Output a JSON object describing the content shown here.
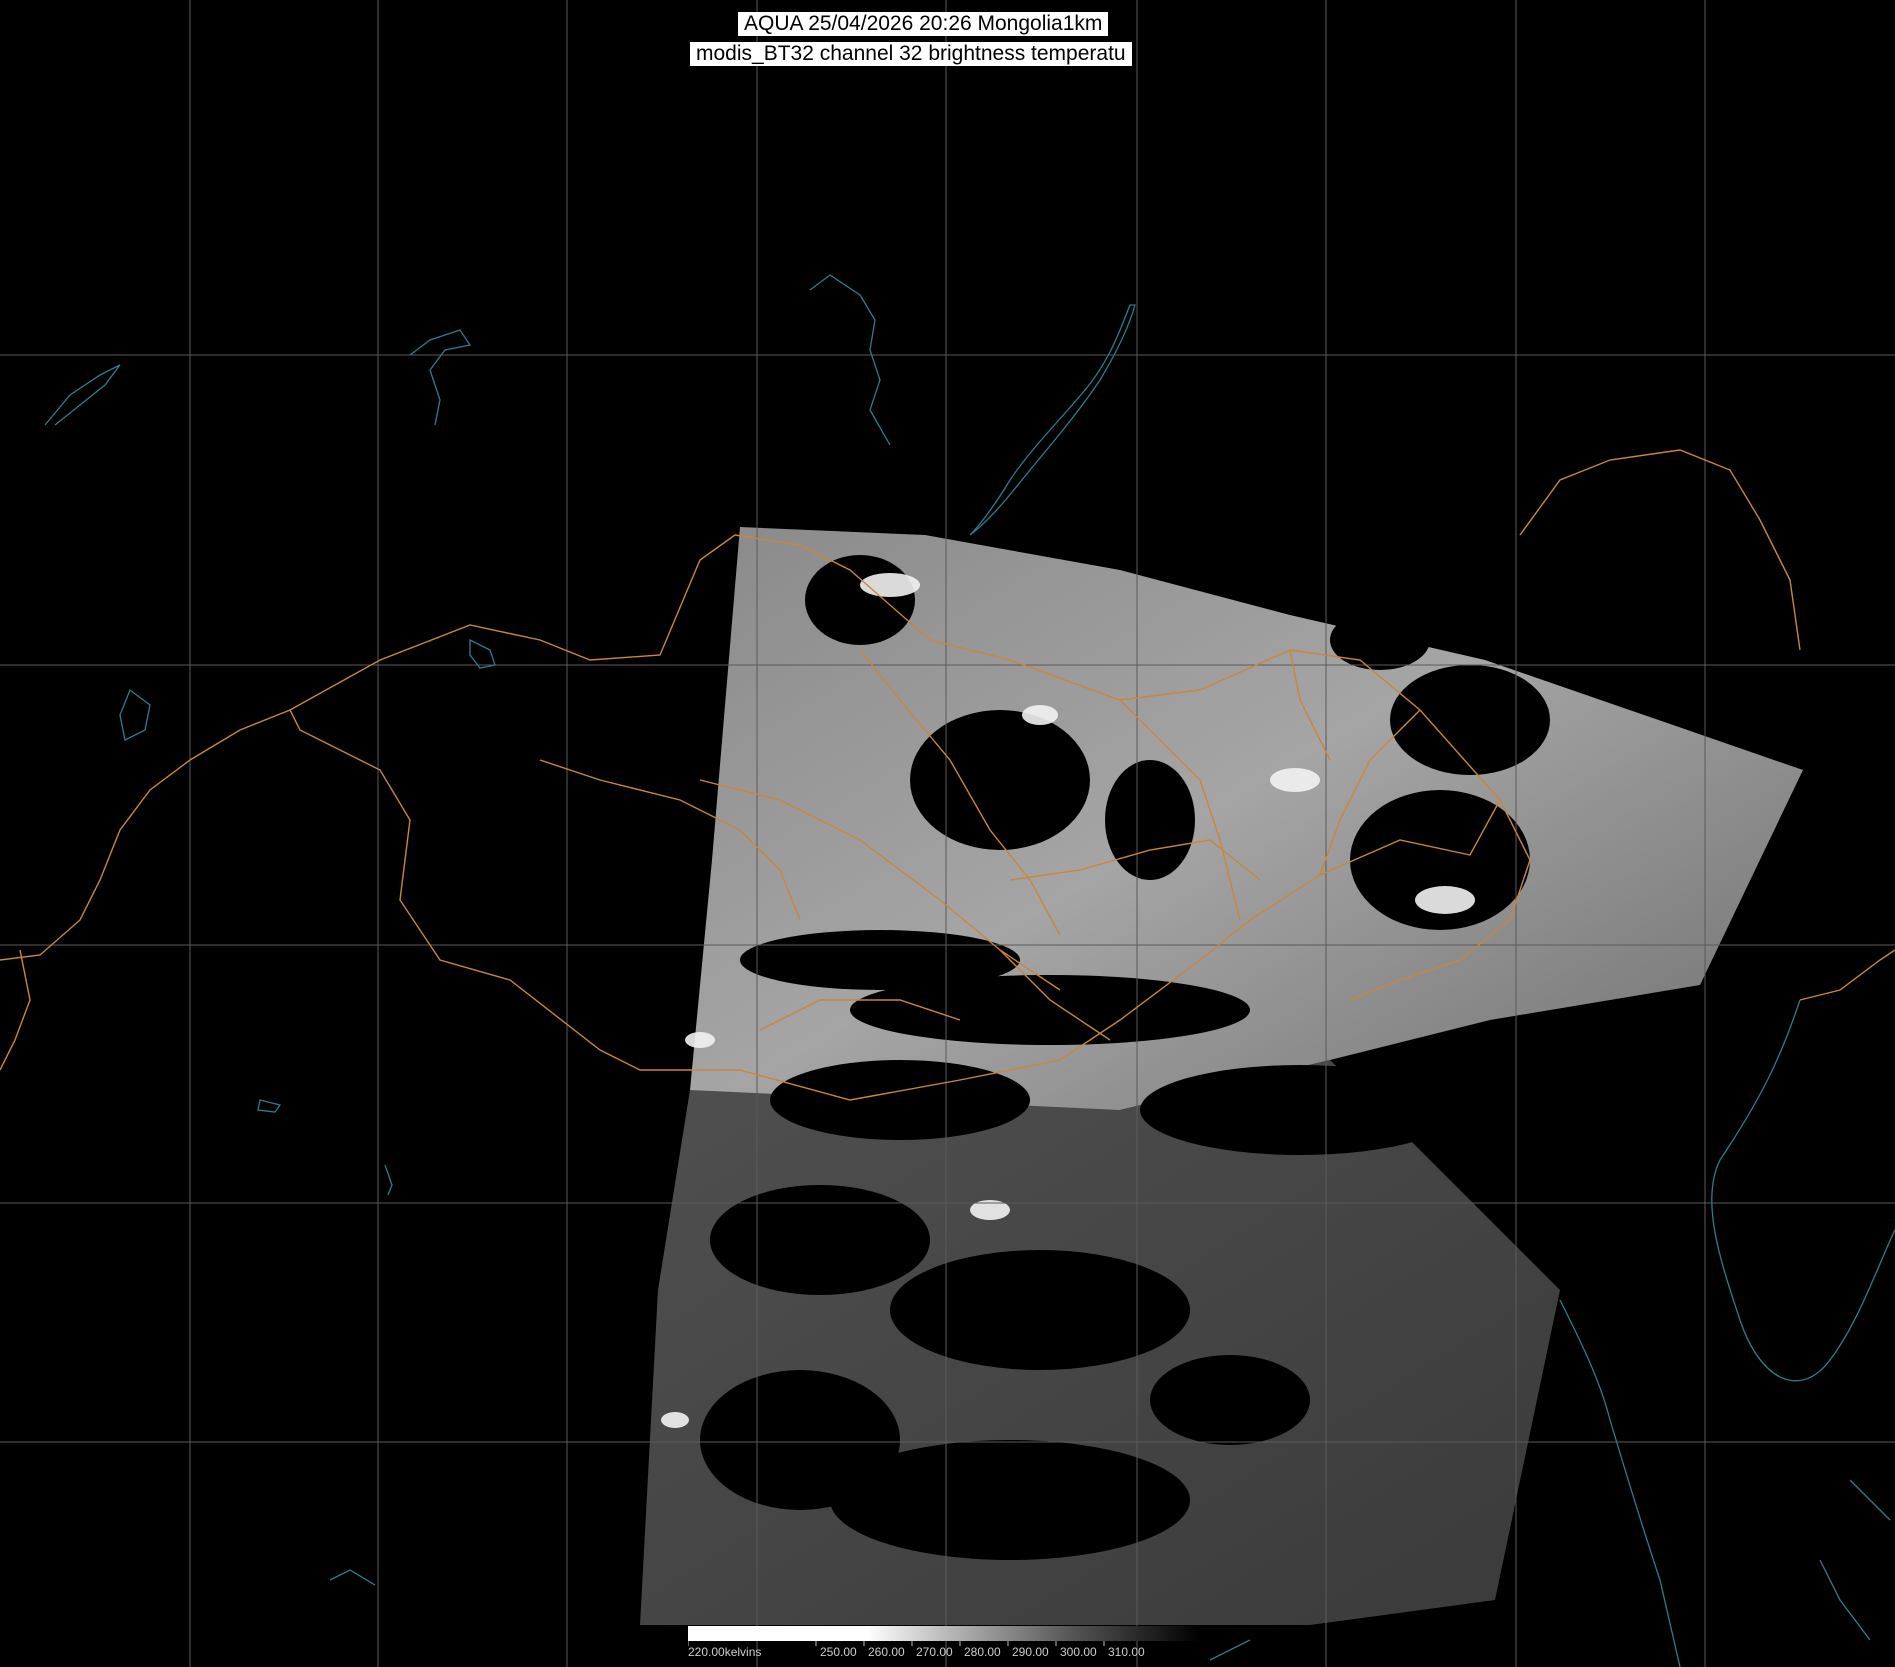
{
  "header": {
    "title_line1": "AQUA 25/04/2026 20:26 Mongolia1km",
    "title_line2": "modis_BT32 channel 32 brightness temperatu"
  },
  "legend": {
    "labels": [
      "220.00kelvins",
      "250.00",
      "260.00",
      "270.00",
      "280.00",
      "290.00",
      "300.00",
      "310.00"
    ]
  },
  "colors": {
    "background": "#000000",
    "grid": "#5a5a5a",
    "coastline": "#2e7d8c",
    "border": "#c8873a",
    "title_box": "#ffffff"
  }
}
